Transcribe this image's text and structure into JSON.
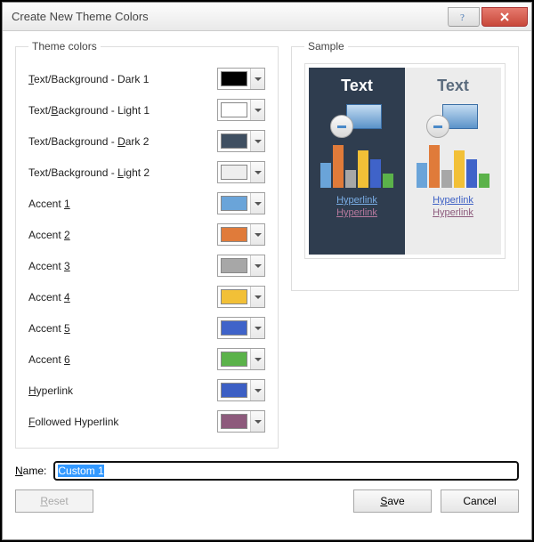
{
  "titlebar": {
    "title": "Create New Theme Colors"
  },
  "groups": {
    "theme_colors": "Theme colors",
    "sample": "Sample"
  },
  "colors": [
    {
      "label_pre": "",
      "key": "T",
      "label_post": "ext/Background - Dark 1",
      "hex": "#000000"
    },
    {
      "label_pre": "Text/",
      "key": "B",
      "label_post": "ackground - Light 1",
      "hex": "#ffffff"
    },
    {
      "label_pre": "Text/Background - ",
      "key": "D",
      "label_post": "ark 2",
      "hex": "#3f4f61"
    },
    {
      "label_pre": "Text/Background - ",
      "key": "L",
      "label_post": "ight 2",
      "hex": "#eeeeee"
    },
    {
      "label_pre": "Accent ",
      "key": "1",
      "label_post": "",
      "hex": "#6aa4d9"
    },
    {
      "label_pre": "Accent ",
      "key": "2",
      "label_post": "",
      "hex": "#e07b3a"
    },
    {
      "label_pre": "Accent ",
      "key": "3",
      "label_post": "",
      "hex": "#a7a7a7"
    },
    {
      "label_pre": "Accent ",
      "key": "4",
      "label_post": "",
      "hex": "#f2c037"
    },
    {
      "label_pre": "Accent ",
      "key": "5",
      "label_post": "",
      "hex": "#3f63c9"
    },
    {
      "label_pre": "Accent ",
      "key": "6",
      "label_post": "",
      "hex": "#5bb24a"
    },
    {
      "label_pre": "",
      "key": "H",
      "label_post": "yperlink",
      "hex": "#3c5fc4"
    },
    {
      "label_pre": "",
      "key": "F",
      "label_post": "ollowed Hyperlink",
      "hex": "#8d5a7c"
    }
  ],
  "sample": {
    "text": "Text",
    "hyperlink": "Hyperlink",
    "followed": "Hyperlink"
  },
  "name": {
    "label_key": "N",
    "label_post": "ame:",
    "value": "Custom 1"
  },
  "buttons": {
    "reset_key": "R",
    "reset_post": "eset",
    "save_key": "S",
    "save_post": "ave",
    "cancel": "Cancel"
  }
}
